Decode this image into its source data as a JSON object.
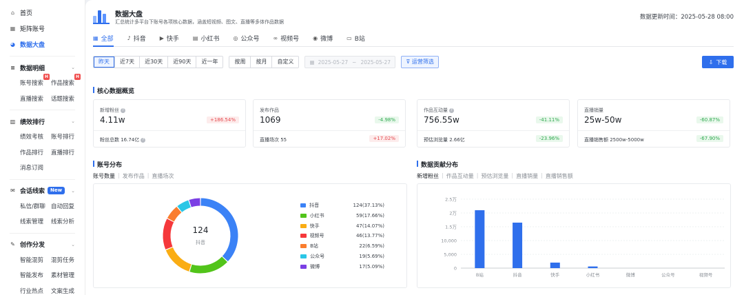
{
  "sidebar": {
    "top": [
      {
        "label": "首页",
        "icon": "home-icon",
        "active": false
      },
      {
        "label": "矩阵账号",
        "icon": "grid-icon",
        "active": false
      },
      {
        "label": "数据大盘",
        "icon": "pie-chart-icon",
        "active": true
      }
    ],
    "groups": [
      {
        "label": "数据明细",
        "icon": "list-icon",
        "chevron": true,
        "rows": [
          [
            {
              "label": "账号搜索",
              "hot": "H"
            },
            {
              "label": "作品搜索",
              "hot": "H"
            }
          ],
          [
            {
              "label": "直播搜索"
            },
            {
              "label": "话题搜索"
            }
          ]
        ]
      },
      {
        "label": "绩效排行",
        "icon": "bar-chart-icon",
        "chevron": true,
        "rows": [
          [
            {
              "label": "绩效考核"
            },
            {
              "label": "账号排行"
            }
          ],
          [
            {
              "label": "作品排行"
            },
            {
              "label": "直播排行"
            }
          ],
          [
            {
              "label": "消息订阅"
            }
          ]
        ]
      },
      {
        "label": "会话线索",
        "icon": "chat-icon",
        "chevron": true,
        "badge": "New",
        "rows": [
          [
            {
              "label": "私信/群聊"
            },
            {
              "label": "自动回复"
            }
          ],
          [
            {
              "label": "线索管理"
            },
            {
              "label": "线索分析"
            }
          ]
        ]
      },
      {
        "label": "创作分发",
        "icon": "edit-icon",
        "chevron": true,
        "rows": [
          [
            {
              "label": "智能混剪"
            },
            {
              "label": "混剪任务"
            }
          ],
          [
            {
              "label": "智能发布"
            },
            {
              "label": "素材管理"
            }
          ],
          [
            {
              "label": "行业热点"
            },
            {
              "label": "文案生成"
            }
          ]
        ]
      }
    ]
  },
  "header": {
    "title": "数据大盘",
    "subtitle": "汇总统计多平台下账号各项核心数据，涵盖短视频、图文、直播等多体作品数据",
    "updated": "数据更新时间：2025-05-28 08:00"
  },
  "tabs": [
    {
      "label": "全部",
      "icon": "grid-icon",
      "active": true
    },
    {
      "label": "抖音",
      "icon": "douyin-icon"
    },
    {
      "label": "快手",
      "icon": "kuaishou-icon"
    },
    {
      "label": "小红书",
      "icon": "xiaohongshu-icon"
    },
    {
      "label": "公众号",
      "icon": "wechat-icon"
    },
    {
      "label": "视频号",
      "icon": "channels-icon"
    },
    {
      "label": "微博",
      "icon": "weibo-icon"
    },
    {
      "label": "B站",
      "icon": "bilibili-icon"
    }
  ],
  "filters": {
    "range": [
      {
        "label": "昨天",
        "active": true
      },
      {
        "label": "近7天"
      },
      {
        "label": "近30天"
      },
      {
        "label": "近90天"
      },
      {
        "label": "近一年"
      }
    ],
    "granularity": [
      {
        "label": "按周"
      },
      {
        "label": "按月"
      },
      {
        "label": "自定义"
      }
    ],
    "date_start": "2025-05-27",
    "date_sep": "~",
    "date_end": "2025-05-27",
    "ops_label": "运营筛选",
    "download_label": "下载"
  },
  "core": {
    "title": "核心数据概览",
    "cards": [
      {
        "label": "新增粉丝",
        "help": true,
        "value": "4.11w",
        "change": "+186.54%",
        "dir": "up",
        "sub_label": "粉丝总数 16.74亿",
        "sub_help": true,
        "sub_change": "",
        "sub_dir": ""
      },
      {
        "label": "发布作品",
        "help": false,
        "value": "1069",
        "change": "-4.98%",
        "dir": "down",
        "sub_label": "直播场次 55",
        "sub_help": false,
        "sub_change": "+17.02%",
        "sub_dir": "up"
      },
      {
        "label": "作品互动量",
        "help": true,
        "value": "756.55w",
        "change": "-41.11%",
        "dir": "down",
        "sub_label": "预估浏览量 2.66亿",
        "sub_help": false,
        "sub_change": "-23.96%",
        "sub_dir": "down"
      },
      {
        "label": "直播销量",
        "help": false,
        "value": "25w-50w",
        "change": "-60.87%",
        "dir": "down",
        "sub_label": "直播销售额 2500w-5000w",
        "sub_help": false,
        "sub_change": "-67.90%",
        "sub_dir": "down"
      }
    ]
  },
  "account_dist": {
    "title": "账号分布",
    "subtabs": [
      {
        "label": "账号数量",
        "active": true
      },
      {
        "label": "发布作品"
      },
      {
        "label": "直播场次"
      }
    ],
    "center_value": "124",
    "center_label": "抖音"
  },
  "contrib": {
    "title": "数据贡献分布",
    "subtabs": [
      {
        "label": "新增粉丝",
        "active": true
      },
      {
        "label": "作品互动量"
      },
      {
        "label": "预估浏览量"
      },
      {
        "label": "直播销量"
      },
      {
        "label": "直播销售额"
      }
    ]
  },
  "chart_data": [
    {
      "type": "pie",
      "title": "账号分布",
      "series": [
        {
          "name": "抖音",
          "value": 124,
          "label": "124(37.13%)",
          "color": "#3b82f6"
        },
        {
          "name": "小红书",
          "value": 59,
          "label": "59(17.66%)",
          "color": "#52c41a"
        },
        {
          "name": "快手",
          "value": 47,
          "label": "47(14.07%)",
          "color": "#faad14"
        },
        {
          "name": "视频号",
          "value": 46,
          "label": "46(13.77%)",
          "color": "#f5383b"
        },
        {
          "name": "B站",
          "value": 22,
          "label": "22(6.59%)",
          "color": "#fa7d2e"
        },
        {
          "name": "公众号",
          "value": 19,
          "label": "19(5.69%)",
          "color": "#2bc6e6"
        },
        {
          "name": "微博",
          "value": 17,
          "label": "17(5.09%)",
          "color": "#7b3fe4"
        }
      ]
    },
    {
      "type": "bar",
      "title": "数据贡献分布",
      "categories": [
        "B站",
        "抖音",
        "快手",
        "小红书",
        "微博",
        "公众号",
        "视频号"
      ],
      "values": [
        21000,
        16500,
        2000,
        600,
        0,
        0,
        0
      ],
      "yticks": [
        "0",
        "5,000",
        "10,000",
        "1.5万",
        "2万",
        "2.5万"
      ],
      "ylim": [
        0,
        25000
      ],
      "grid": true,
      "color": "#2f6fec"
    }
  ]
}
